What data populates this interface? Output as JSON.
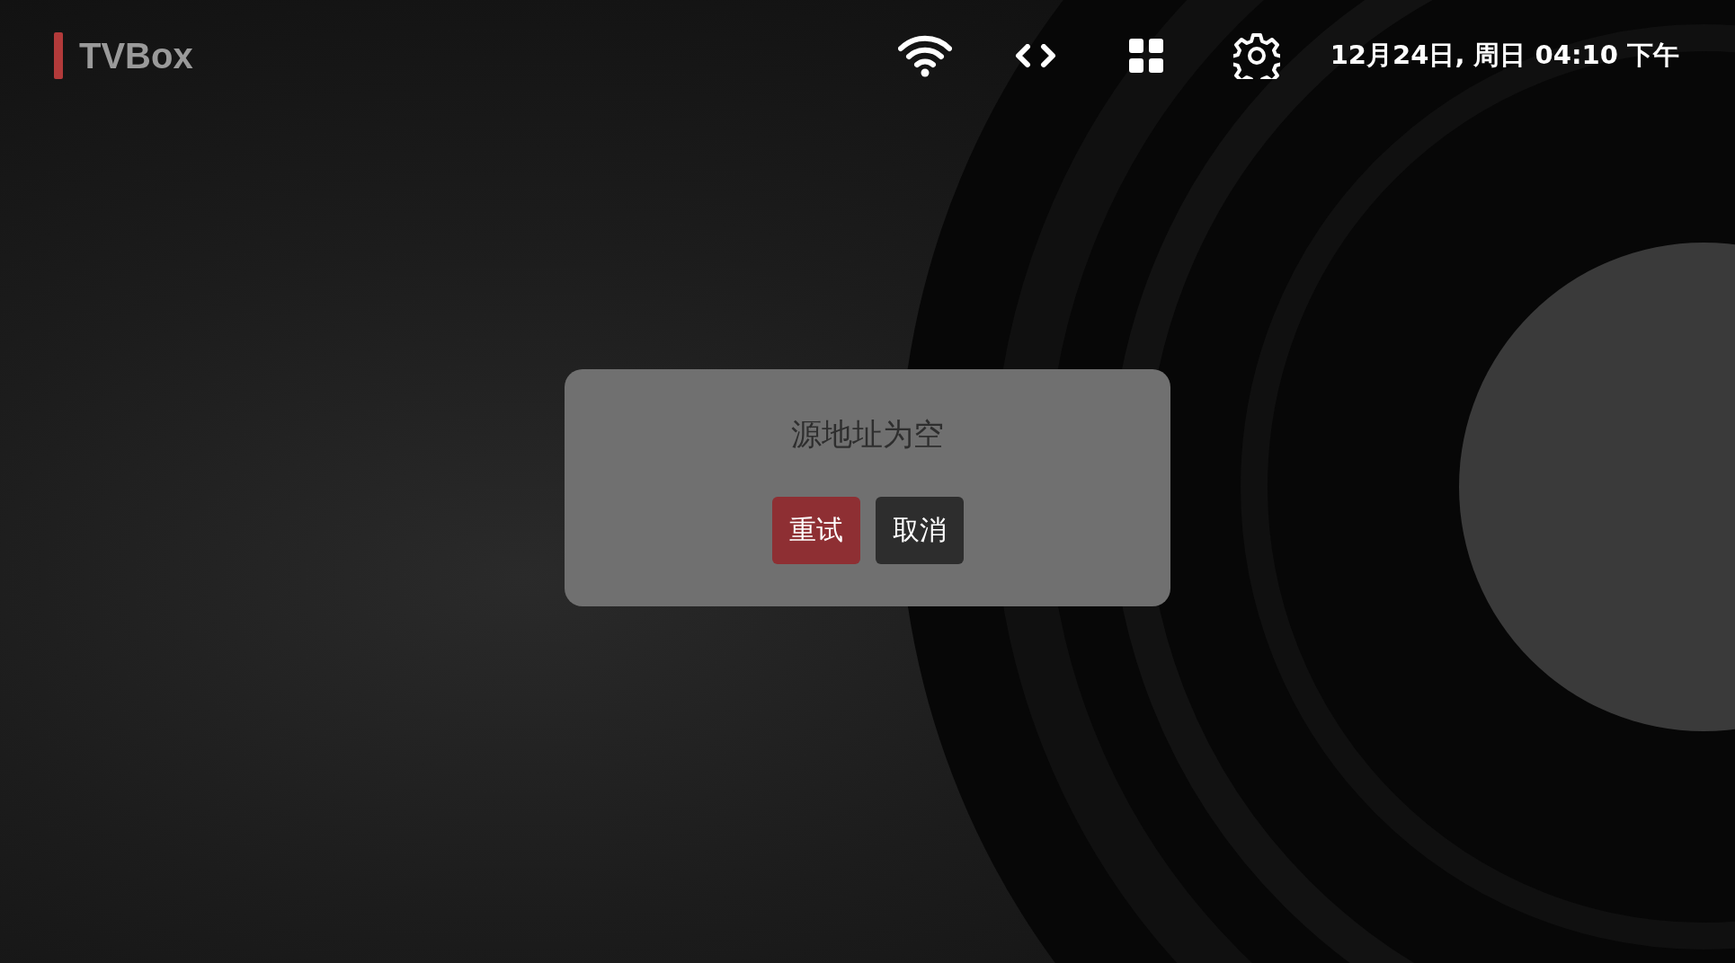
{
  "header": {
    "logo": "TVBox",
    "datetime": "12月24日, 周日 04:10 下午"
  },
  "dialog": {
    "message": "源地址为空",
    "buttons": [
      {
        "label": "重试",
        "selected": true
      },
      {
        "label": "取消",
        "selected": false
      }
    ]
  }
}
